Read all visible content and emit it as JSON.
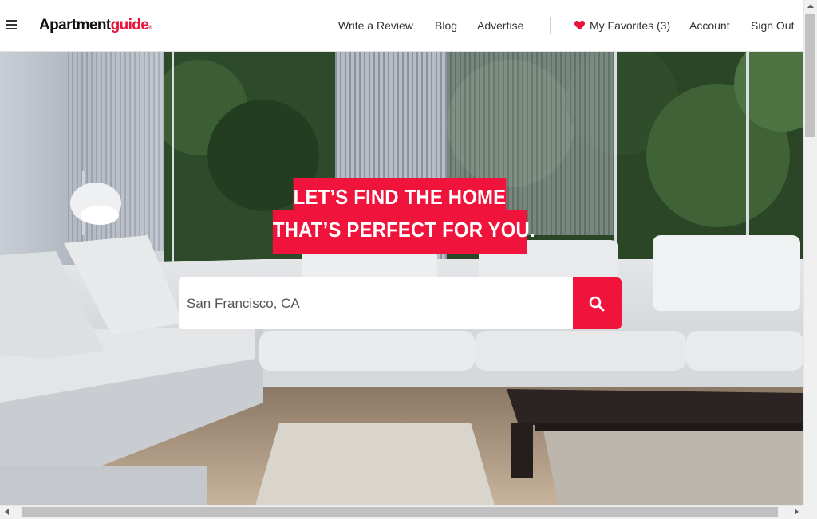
{
  "header": {
    "logo": {
      "part1": "Apartment",
      "part2": "guide",
      "reg": "®"
    },
    "nav": {
      "write_review": "Write a Review",
      "blog": "Blog",
      "advertise": "Advertise",
      "favorites": "My Favorites (3)",
      "account": "Account",
      "sign_out": "Sign Out"
    },
    "icons": {
      "menu": "hamburger-menu-icon",
      "favorites": "heart-icon"
    }
  },
  "hero": {
    "headline_line1": "LET’S FIND THE HOME",
    "headline_line2": "THAT’S PERFECT FOR YOU.",
    "search": {
      "value": "San Francisco, CA",
      "placeholder": ""
    },
    "search_icon": "magnifier-icon"
  },
  "colors": {
    "brand_red": "#f0143c",
    "text_dark": "#333333",
    "header_bg": "#ffffff"
  }
}
